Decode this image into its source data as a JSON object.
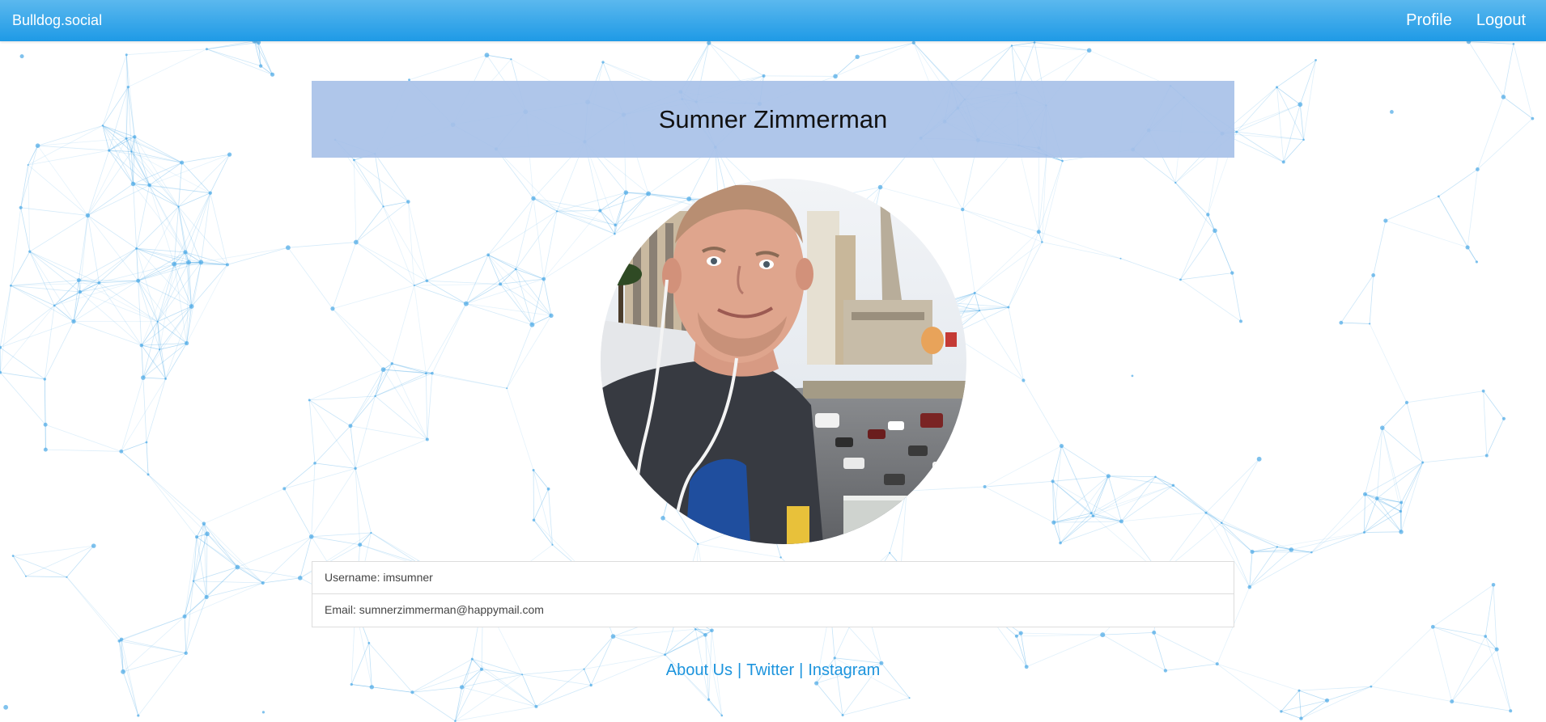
{
  "navbar": {
    "brand": "Bulldog.social",
    "links": [
      "Profile",
      "Logout"
    ]
  },
  "profile": {
    "name": "Sumner Zimmerman",
    "username_line": "Username: imsumner",
    "email_line": "Email: sumnerzimmerman@happymail.com"
  },
  "footer": {
    "links": [
      "About Us",
      "Twitter",
      "Instagram"
    ],
    "separator": "|"
  },
  "colors": {
    "navbar_top": "#5bb8ee",
    "navbar_bottom": "#1e9ae6",
    "banner": "#a8c1e8",
    "link": "#1c94dd",
    "network": "#4aa8e6"
  },
  "icons": {
    "background": "network-mesh-pattern",
    "avatar": "profile-photo"
  }
}
